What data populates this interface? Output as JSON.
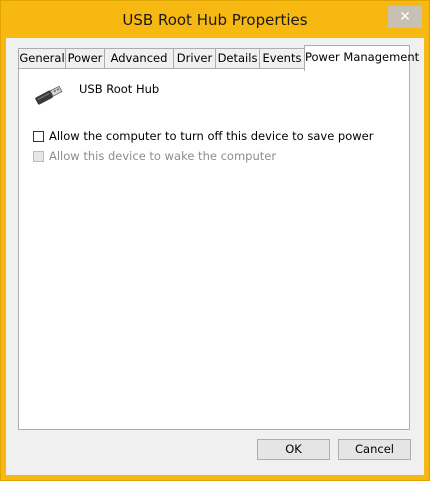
{
  "window": {
    "title": "USB Root Hub Properties",
    "close_glyph": "✕"
  },
  "tabs": [
    {
      "label": "General"
    },
    {
      "label": "Power"
    },
    {
      "label": "Advanced"
    },
    {
      "label": "Driver"
    },
    {
      "label": "Details"
    },
    {
      "label": "Events"
    },
    {
      "label": "Power Management",
      "active": true
    }
  ],
  "device": {
    "name": "USB Root Hub",
    "icon": "usb-plug-icon"
  },
  "options": {
    "allow_turn_off": {
      "label": "Allow the computer to turn off this device to save power",
      "checked": false,
      "enabled": true
    },
    "allow_wake": {
      "label": "Allow this device to wake the computer",
      "checked": false,
      "enabled": false
    }
  },
  "buttons": {
    "ok": "OK",
    "cancel": "Cancel"
  },
  "colors": {
    "frame": "#f7b812",
    "client_bg": "#f0f0f0",
    "panel_bg": "#ffffff",
    "disabled_text": "#8d8d8d"
  }
}
